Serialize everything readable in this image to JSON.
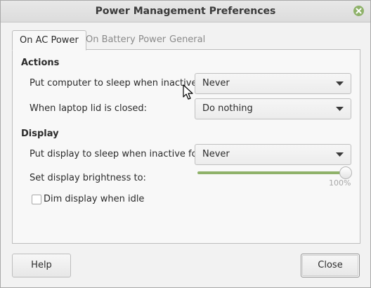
{
  "window": {
    "title": "Power Management Preferences"
  },
  "tabs": [
    {
      "label": "On AC Power",
      "active": true
    },
    {
      "label": "On Battery Power",
      "active": false
    },
    {
      "label": "General",
      "active": false
    }
  ],
  "actions": {
    "heading": "Actions",
    "sleep_label": "Put computer to sleep when inactive for:",
    "sleep_value": "Never",
    "lid_label": "When laptop lid is closed:",
    "lid_value": "Do nothing"
  },
  "display": {
    "heading": "Display",
    "display_sleep_label": "Put display to sleep when inactive for:",
    "display_sleep_value": "Never",
    "brightness_label": "Set display brightness to:",
    "brightness_value": "100%",
    "brightness_fraction": 1.0,
    "dim_label": "Dim display when idle",
    "dim_checked": false
  },
  "buttons": {
    "help": "Help",
    "close": "Close"
  },
  "colors": {
    "accent": "#8fb26a"
  },
  "icons": [
    "close-icon",
    "chevron-down-icon",
    "mouse-pointer-icon"
  ]
}
